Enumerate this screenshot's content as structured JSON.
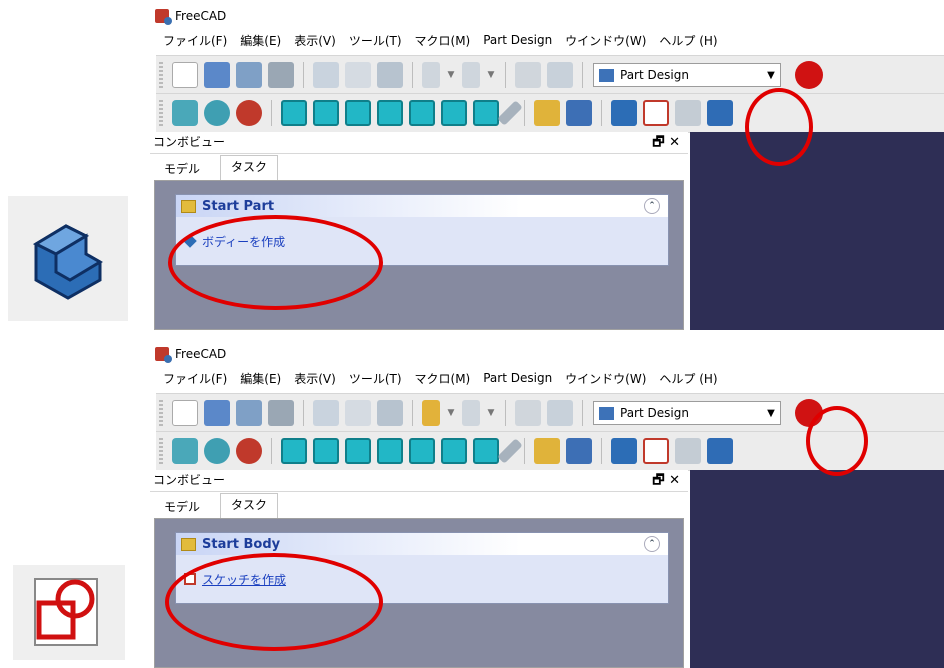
{
  "panels": [
    {
      "window_title": "FreeCAD",
      "menu": [
        "ファイル(F)",
        "編集(E)",
        "表示(V)",
        "ツール(T)",
        "マクロ(M)",
        "Part Design",
        "ウインドウ(W)",
        "ヘルプ (H)"
      ],
      "workbench": "Part Design",
      "combo_title": "コンボビュー",
      "tabs": [
        "モデル",
        "タスク"
      ],
      "task_header": "Start Part",
      "task_action": "ボディーを作成",
      "big_icon": "part-design-body-icon"
    },
    {
      "window_title": "FreeCAD",
      "menu": [
        "ファイル(F)",
        "編集(E)",
        "表示(V)",
        "ツール(T)",
        "マクロ(M)",
        "Part Design",
        "ウインドウ(W)",
        "ヘルプ (H)"
      ],
      "workbench": "Part Design",
      "combo_title": "コンボビュー",
      "tabs": [
        "モデル",
        "タスク"
      ],
      "task_header": "Start Body",
      "task_action": "スケッチを作成",
      "big_icon": "new-sketch-icon"
    }
  ],
  "colors": {
    "highlight_ring": "#e00000",
    "task_link": "#1a3fbf",
    "body_icon": "#2c6db6",
    "sketch_icon": "#c0392b",
    "view_background": "#2e2e55"
  }
}
